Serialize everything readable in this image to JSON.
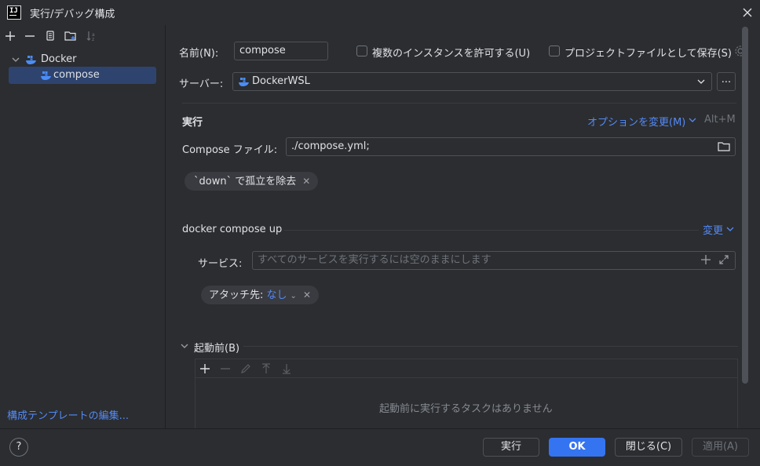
{
  "window": {
    "title": "実行/デバッグ構成",
    "logo_text": "IJ"
  },
  "sidebar": {
    "tree": [
      {
        "label": "Docker",
        "expanded": true
      },
      {
        "label": "compose",
        "selected": true
      }
    ],
    "edit_templates_link": "構成テンプレートの編集..."
  },
  "form": {
    "name_label": "名前(N):",
    "name_value": "compose",
    "allow_multiple_label": "複数のインスタンスを許可する(U)",
    "allow_multiple_checked": false,
    "store_as_project_file_label": "プロジェクトファイルとして保存(S)",
    "store_as_project_file_checked": false,
    "server_label": "サーバー:",
    "server_value": "DockerWSL",
    "server_more": "...",
    "run_section": "実行",
    "modify_options": "オプションを変更(M)",
    "modify_options_shortcut": "Alt+M",
    "compose_file_label": "Compose ファイル:",
    "compose_file_value": "./compose.yml;",
    "down_chip": "`down` で孤立を除去",
    "compose_up_section": "docker compose up",
    "change_link": "変更",
    "services_label": "サービス:",
    "services_placeholder": "すべてのサービスを実行するには空のままにします",
    "attach_chip_label": "アタッチ先:",
    "attach_chip_value": "なし",
    "before_launch_label": "起動前(B)",
    "before_launch_empty": "起動前に実行するタスクはありません"
  },
  "footer": {
    "help": "?",
    "run": "実行",
    "ok": "OK",
    "close": "閉じる(C)",
    "apply": "適用(A)"
  },
  "colors": {
    "background": "#2b2d30",
    "accent": "#3574f0",
    "link": "#548af7",
    "docker_blue": "#4a8df8",
    "selection": "#2e436e"
  }
}
